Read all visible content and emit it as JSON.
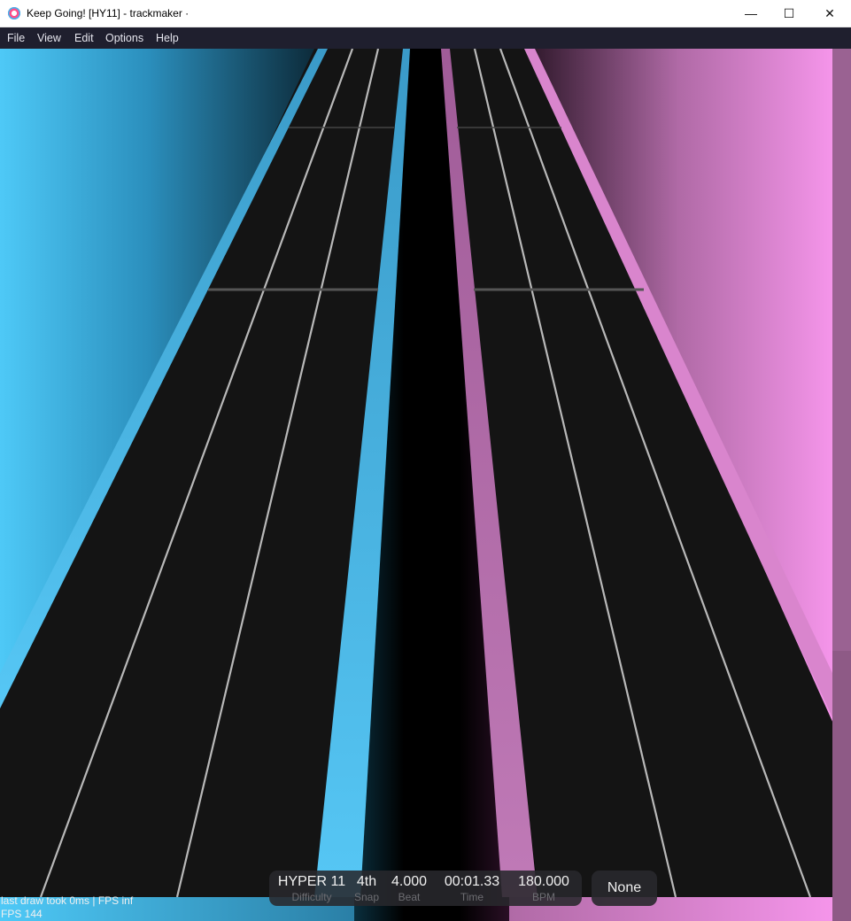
{
  "window": {
    "title": "Keep Going! [HY11] - trackmaker ·",
    "app_icon": "heart-icon",
    "controls": {
      "minimize": "—",
      "maximize": "☐",
      "close": "✕"
    }
  },
  "menu": {
    "items": [
      "File",
      "View",
      "Edit",
      "Options",
      "Help"
    ]
  },
  "colors": {
    "left_accent": "#4ec9f7",
    "right_accent": "#ef92e6",
    "track_floor": "#141414",
    "menubar_bg": "#1f1f2e"
  },
  "hud": {
    "difficulty": {
      "value": "HYPER 11",
      "label": "Difficulty"
    },
    "snap": {
      "value": "4th",
      "label": "Snap"
    },
    "beat": {
      "value": "4.000",
      "label": "Beat"
    },
    "time": {
      "value": "00:01.33",
      "label": "Time"
    },
    "bpm": {
      "value": "180.000",
      "label": "BPM"
    }
  },
  "layer": {
    "value": "None"
  },
  "debug": {
    "line1": "last draw took 0ms | FPS inf",
    "line2": "FPS 144"
  }
}
